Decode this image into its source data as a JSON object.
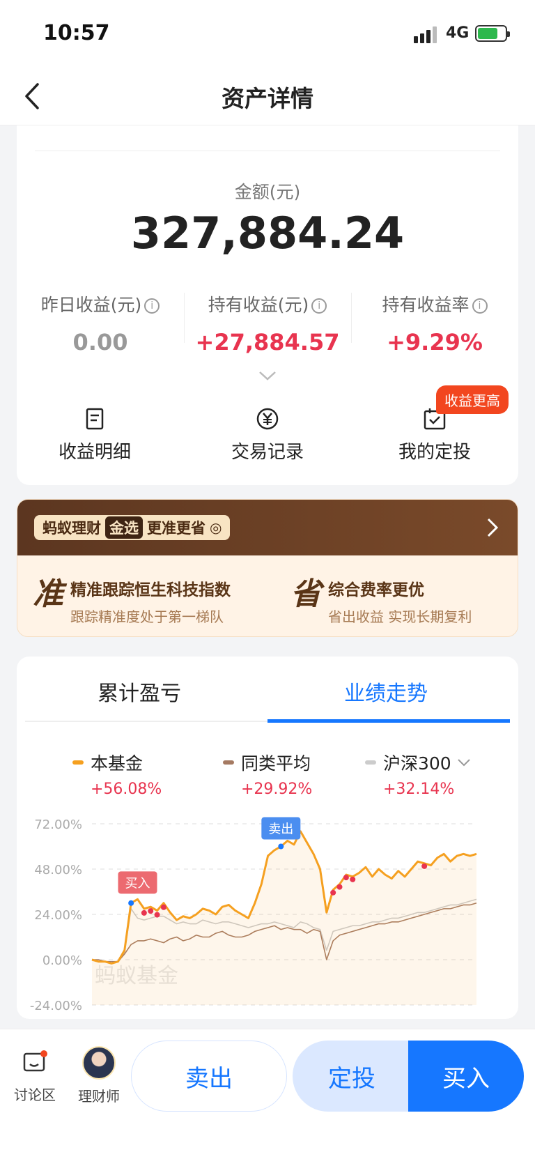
{
  "status_bar": {
    "time": "10:57",
    "network": "4G"
  },
  "nav": {
    "title": "资产详情"
  },
  "asset": {
    "amount_label": "金额(元)",
    "amount": "327,884.24",
    "stats": [
      {
        "label": "昨日收益(元)",
        "value": "0.00",
        "color": "#999999"
      },
      {
        "label": "持有收益(元)",
        "value": "+27,884.57",
        "color": "#e8344f"
      },
      {
        "label": "持有收益率",
        "value": "+9.29%",
        "color": "#e8344f"
      }
    ],
    "actions": [
      {
        "label": "收益明细",
        "icon": "document-icon"
      },
      {
        "label": "交易记录",
        "icon": "yuan-coin-icon"
      },
      {
        "label": "我的定投",
        "icon": "calendar-check-icon"
      }
    ],
    "badge": "收益更高"
  },
  "banner": {
    "brand": "蚂蚁理财",
    "gold": "金选",
    "slogan": "更准更省",
    "features": [
      {
        "big": "准",
        "title": "精准跟踪恒生科技指数",
        "sub": "跟踪精准度处于第一梯队"
      },
      {
        "big": "省",
        "title": "综合费率更优",
        "sub": "省出收益 实现长期复利"
      }
    ]
  },
  "performance": {
    "tabs": [
      "累计盈亏",
      "业绩走势"
    ],
    "active_tab": 1,
    "legend": [
      {
        "name": "本基金",
        "pct": "+56.08%",
        "color": "#f5a020"
      },
      {
        "name": "同类平均",
        "pct": "+29.92%",
        "color": "#a57a62"
      },
      {
        "name": "沪深300",
        "pct": "+32.14%",
        "color": "#cccccc"
      }
    ],
    "watermark": "蚂蚁基金",
    "markers": {
      "buy": "买入",
      "sell": "卖出"
    }
  },
  "chart_data": {
    "type": "line",
    "y_ticks": [
      "72.00%",
      "48.00%",
      "24.00%",
      "0.00%",
      "-24.00%"
    ],
    "ylim": [
      -24,
      72
    ],
    "series": [
      {
        "name": "本基金",
        "values": [
          0,
          -1,
          -1,
          -2,
          -1,
          5,
          30,
          32,
          27,
          28,
          26,
          30,
          25,
          21,
          23,
          22,
          24,
          27,
          26,
          24,
          28,
          29,
          26,
          24,
          22,
          30,
          40,
          55,
          58,
          60,
          63,
          61,
          68,
          62,
          56,
          48,
          25,
          37,
          40,
          45,
          44,
          46,
          49,
          44,
          48,
          45,
          43,
          47,
          44,
          48,
          52,
          51,
          50,
          54,
          56,
          52,
          55,
          56,
          55,
          56
        ]
      },
      {
        "name": "同类平均",
        "values": [
          0,
          0,
          -1,
          -1,
          -1,
          3,
          8,
          10,
          10,
          11,
          10,
          9,
          11,
          12,
          10,
          11,
          13,
          12,
          12,
          14,
          15,
          13,
          12,
          12,
          13,
          15,
          16,
          17,
          18,
          16,
          17,
          16,
          16,
          14,
          16,
          15,
          0,
          10,
          13,
          14,
          15,
          16,
          17,
          18,
          19,
          19,
          20,
          20,
          21,
          22,
          23,
          24,
          25,
          26,
          27,
          27,
          28,
          29,
          29,
          30
        ]
      },
      {
        "name": "沪深300",
        "values": [
          0,
          -1,
          -1,
          -2,
          -1,
          4,
          27,
          22,
          21,
          22,
          23,
          23,
          21,
          19,
          20,
          19,
          19,
          21,
          20,
          19,
          20,
          20,
          19,
          18,
          17,
          18,
          19,
          19,
          20,
          19,
          18,
          17,
          20,
          19,
          17,
          16,
          5,
          15,
          16,
          17,
          18,
          18,
          19,
          20,
          20,
          21,
          22,
          22,
          23,
          24,
          25,
          25,
          26,
          27,
          28,
          29,
          29,
          30,
          31,
          32
        ]
      }
    ]
  },
  "bottom_bar": {
    "discussion": "讨论区",
    "advisor": "理财师",
    "sell": "卖出",
    "dca": "定投",
    "buy": "买入"
  }
}
